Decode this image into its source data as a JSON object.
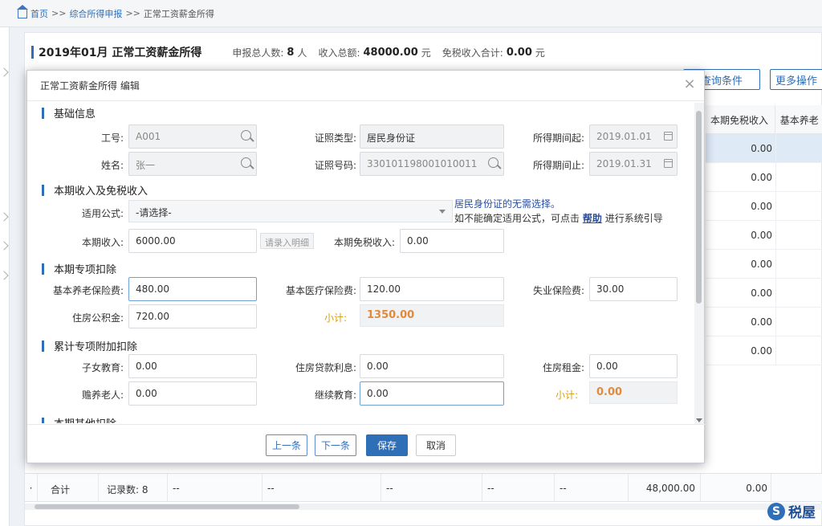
{
  "breadcrumb": {
    "home": "首页",
    "level2": "综合所得申报",
    "current": "正常工资薪金所得",
    "sep": ">>"
  },
  "summary": {
    "title": "2019年01月 正常工资薪金所得",
    "total_people_label": "申报总人数:",
    "total_people": "8",
    "total_people_unit": "人",
    "total_income_label": "收入总额:",
    "total_income": "48000.00",
    "total_income_unit": "元",
    "taxfree_label": "免税收入合计:",
    "taxfree": "0.00",
    "taxfree_unit": "元"
  },
  "toolbar": {
    "query_conditions": "查询条件",
    "more_ops": "更多操作"
  },
  "table": {
    "headers": [
      "本期免税收入",
      "基本养老"
    ],
    "rows": [
      "0.00",
      "0.00",
      "0.00",
      "0.00",
      "0.00",
      "0.00",
      "0.00",
      "0.00"
    ],
    "total": {
      "label": "合计",
      "records": "记录数: 8",
      "dash": "--",
      "income": "48,000.00",
      "taxfree": "0.00"
    }
  },
  "logo": {
    "text": "税屋",
    "mark": "S"
  },
  "modal": {
    "title": "正常工资薪金所得 编辑",
    "close": "×",
    "sections": {
      "basic": "基础信息",
      "income": "本期收入及免税收入",
      "special": "本期专项扣除",
      "cumulative": "累计专项附加扣除",
      "other": "本期其他扣除"
    },
    "basic": {
      "emp_no_label": "工号:",
      "emp_no": "A001",
      "id_type_label": "证照类型:",
      "id_type": "居民身份证",
      "period_start_label": "所得期间起:",
      "period_start": "2019.01.01",
      "name_label": "姓名:",
      "name": "张一",
      "id_no_label": "证照号码:",
      "id_no": "330101198001010011",
      "period_end_label": "所得期间止:",
      "period_end": "2019.01.31"
    },
    "income": {
      "formula_label": "适用公式:",
      "formula": "-请选择-",
      "hint1": "居民身份证的无需选择。",
      "hint2_pre": "如不能确定适用公式，可点击",
      "hint2_link": "帮助",
      "hint2_post": "进行系统引导",
      "income_label": "本期收入:",
      "income": "6000.00",
      "detail_btn": "请录入明细",
      "taxfree_label": "本期免税收入:",
      "taxfree": "0.00"
    },
    "special": {
      "pension_label": "基本养老保险费:",
      "pension": "480.00",
      "medical_label": "基本医疗保险费:",
      "medical": "120.00",
      "unemployment_label": "失业保险费:",
      "unemployment": "30.00",
      "housing_label": "住房公积金:",
      "housing": "720.00",
      "subtotal_label": "小计:",
      "subtotal": "1350.00"
    },
    "cumulative": {
      "children_label": "子女教育:",
      "children": "0.00",
      "loan_label": "住房贷款利息:",
      "loan": "0.00",
      "rent_label": "住房租金:",
      "rent": "0.00",
      "elderly_label": "赡养老人:",
      "elderly": "0.00",
      "continuing_label": "继续教育:",
      "continuing": "0.00",
      "subtotal_label": "小计:",
      "subtotal": "0.00"
    },
    "footer": {
      "prev": "上一条",
      "next": "下一条",
      "save": "保存",
      "cancel": "取消"
    }
  }
}
